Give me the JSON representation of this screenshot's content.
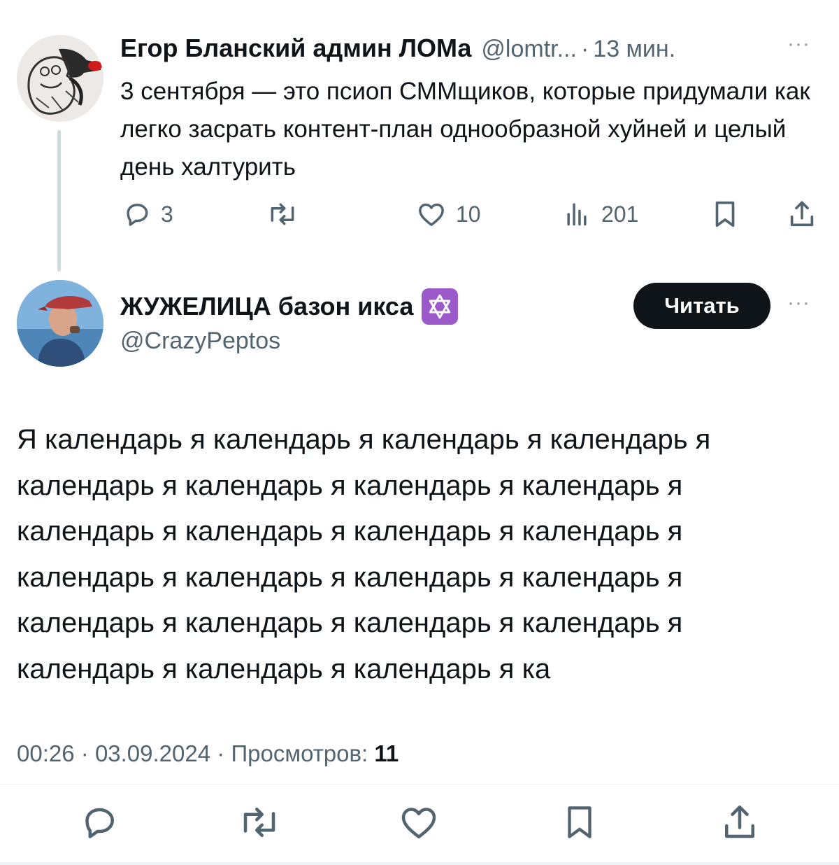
{
  "parent_tweet": {
    "author_name": "Егор Бланский админ ЛОМа",
    "handle": "@lomtr...",
    "separator": "·",
    "time": "13 мин.",
    "text": "3 сентября — это псиоп СММщиков, которые придумали как легко засрать контент-план однообразной хуйней и целый день халтурить",
    "replies": "3",
    "retweets": "",
    "likes": "10",
    "views": "201",
    "more_label": "···"
  },
  "main_tweet": {
    "author_name": "ЖУЖЕЛИЦА базон икса",
    "badge_glyph": "✡",
    "handle": "@CrazyPeptos",
    "follow_label": "Читать",
    "more_label": "···",
    "text": "Я календарь я календарь я календарь я календарь я календарь я календарь я календарь я календарь я календарь я календарь я календарь я календарь я календарь я календарь я календарь я календарь я календарь я календарь я календарь я календарь я календарь я календарь я календарь я ка",
    "time": "00:26",
    "date": "03.09.2024",
    "views_label": "Просмотров:",
    "views_count": "11",
    "separator": "·"
  },
  "colors": {
    "text": "#0f1419",
    "muted": "#536471",
    "button_bg": "#0f1419",
    "button_text": "#ffffff",
    "thread_line": "#cfd9de",
    "badge": "#9b59c9"
  },
  "icons": [
    "reply-icon",
    "retweet-icon",
    "like-icon",
    "views-icon",
    "bookmark-icon",
    "share-icon",
    "more-icon",
    "star-of-david-icon"
  ]
}
